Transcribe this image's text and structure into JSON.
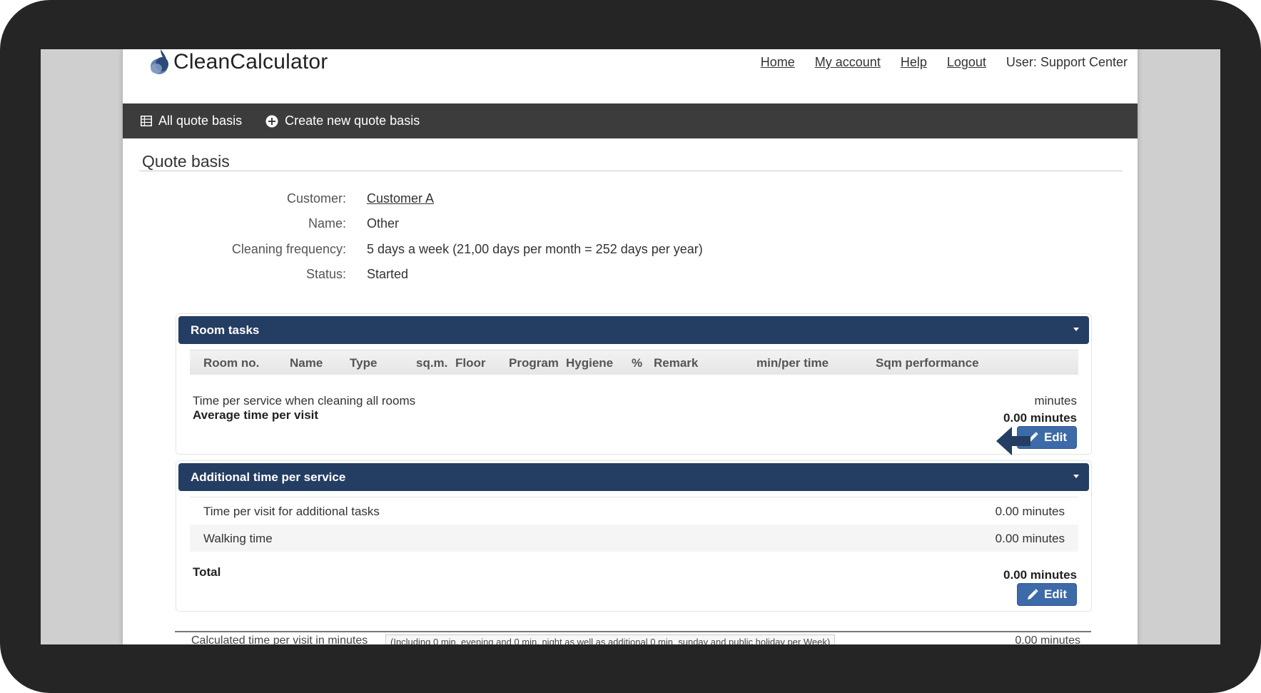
{
  "app": {
    "logo_text": "CleanCalculator",
    "nav": {
      "home": "Home",
      "my_account": "My account",
      "help": "Help",
      "logout": "Logout",
      "user": "User: Support Center"
    }
  },
  "toolbar": {
    "all_quote_basis": "All quote basis",
    "create_new": "Create new quote basis"
  },
  "page_title": "Quote basis",
  "details": {
    "customer_label": "Customer:",
    "customer_value": "Customer A",
    "name_label": "Name:",
    "name_value": "Other",
    "frequency_label": "Cleaning frequency:",
    "frequency_value": "5 days a week (21,00 days per month = 252 days per year)",
    "status_label": "Status:",
    "status_value": "Started"
  },
  "room_tasks": {
    "title": "Room tasks",
    "columns": [
      "Room no.",
      "Name",
      "Type",
      "sq.m.",
      "Floor",
      "Program",
      "Hygiene",
      "%",
      "Remark",
      "min/per time",
      "Sqm performance"
    ],
    "time_per_service_label": "Time per service when cleaning all rooms",
    "time_per_service_value": "minutes",
    "average_label": "Average time per visit",
    "average_value": "0.00 minutes",
    "edit_label": "Edit"
  },
  "additional": {
    "title": "Additional time per service",
    "rows": [
      {
        "label": "Time per visit for additional tasks",
        "value": "0.00 minutes"
      },
      {
        "label": "Walking time",
        "value": "0.00 minutes"
      }
    ],
    "total_label": "Total",
    "total_value": "0.00 minutes",
    "edit_label": "Edit"
  },
  "footer": {
    "calc_label": "Calculated time per visit in minutes",
    "calc_note": "(Including 0 min. evening and 0 min. night as well as additional 0 min. sunday and public holiday per Week)",
    "calc_value": "0.00 minutes"
  },
  "colors": {
    "panel_header": "#243d63",
    "edit_button": "#3d6aa8",
    "toolbar": "#3c3c3c",
    "arrow": "#243d63"
  }
}
